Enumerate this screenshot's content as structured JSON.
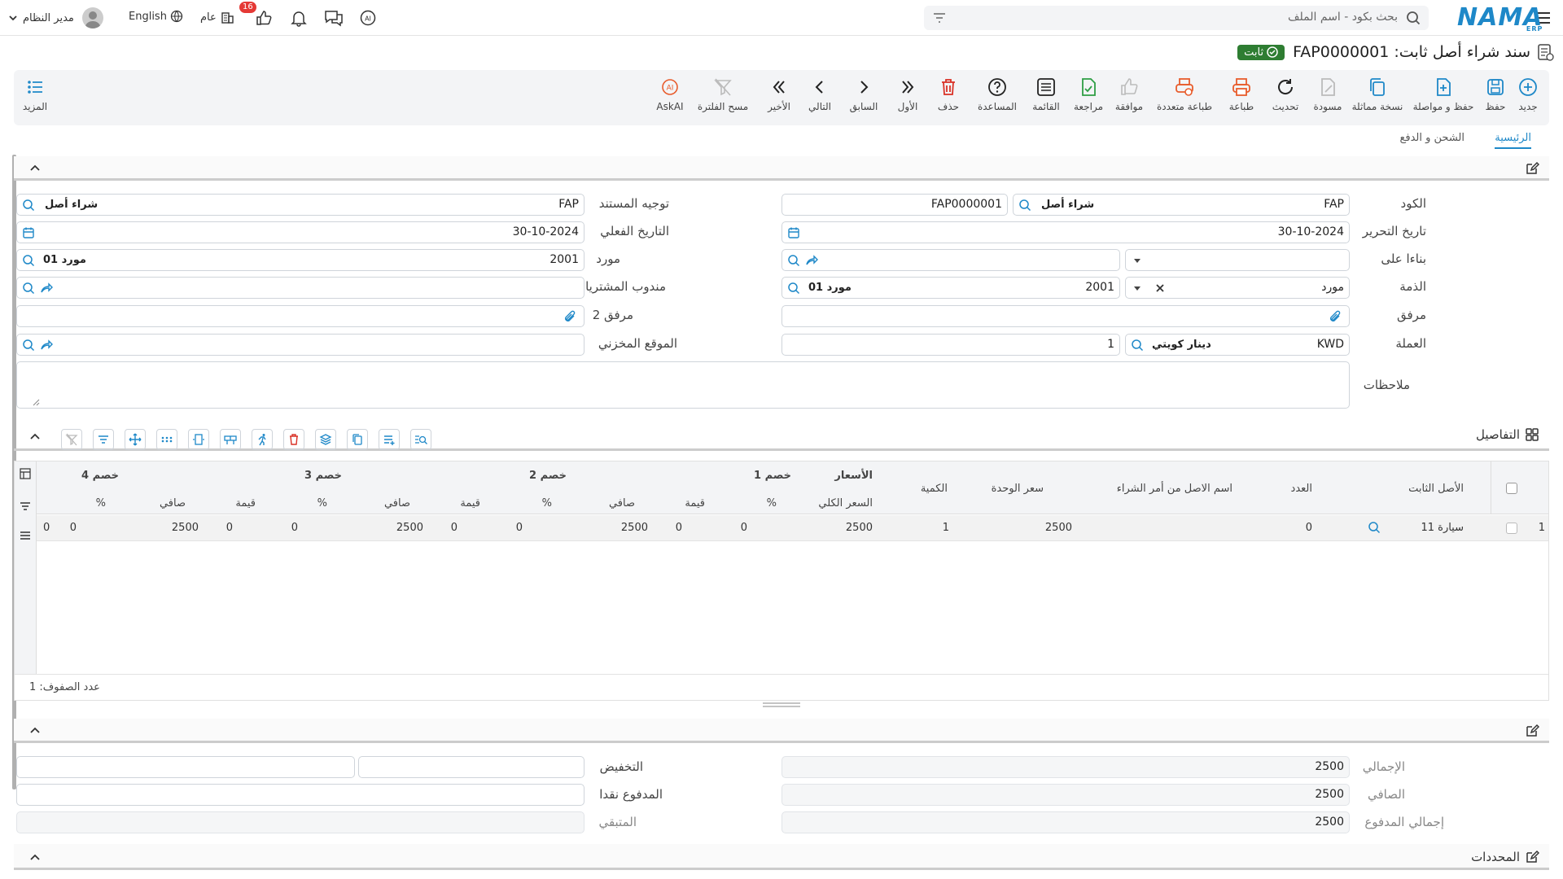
{
  "topbar": {
    "search_placeholder": "بحث بكود - اسم الملف",
    "logo": "NAMA",
    "logo_sub": "ERP",
    "user_name": "مدير النظام",
    "language": "English",
    "general": "عام",
    "notif_count": "16"
  },
  "title": {
    "text": "سند شراء أصل ثابت: FAP0000001",
    "status": "ثابت"
  },
  "toolbar": {
    "new": "جديد",
    "save": "حفظ",
    "save_continue": "حفظ و مواصلة",
    "duplicate": "نسخة مماثلة",
    "draft": "مسودة",
    "refresh": "تحديث",
    "print": "طباعة",
    "multi_print": "طباعة متعددة",
    "approve": "موافقة",
    "review": "مراجعة",
    "list": "القائمة",
    "help": "المساعدة",
    "delete": "حذف",
    "first": "الأول",
    "previous": "السابق",
    "next": "التالي",
    "last": "الأخير",
    "clear_filter": "مسح الفلترة",
    "askai": "AskAI",
    "more": "المزيد"
  },
  "tabs": {
    "main": "الرئيسية",
    "shipping": "الشحن و الدفع"
  },
  "form": {
    "code_label": "الكود",
    "code_value": "FAP",
    "code_type": "شراء أصل",
    "code_number": "FAP0000001",
    "date_label": "تاريخ التحرير",
    "date_value": "30-10-2024",
    "based_on_label": "بناءا على",
    "liability_label": "الذمة",
    "liability_type": "مورد",
    "liability_code": "2001",
    "liability_name": "مورد 01",
    "attachment_label": "مرفق",
    "currency_label": "العملة",
    "currency_code": "KWD",
    "currency_name": "دينار كويتي",
    "currency_rate": "1",
    "notes_label": "ملاحظات",
    "direction_label": "توجيه المستند",
    "direction_value": "FAP",
    "direction_type": "شراء أصل",
    "actual_date_label": "التاريخ الفعلي",
    "actual_date_value": "30-10-2024",
    "supplier_label": "مورد",
    "supplier_code": "2001",
    "supplier_name": "مورد 01",
    "rep_label": "مندوب المشتريات",
    "attachment2_label": "مرفق 2",
    "warehouse_label": "الموقع المخزني"
  },
  "details": {
    "title": "التفاصيل",
    "headers": {
      "asset": "الأصل الثابت",
      "count": "العدد",
      "po_name": "اسم الاصل من أمر الشراء",
      "unit_price": "سعر الوحدة",
      "qty": "الكمية",
      "prices_group": "الأسعار",
      "total_price": "السعر الكلي",
      "disc1": "خصم 1",
      "disc2": "خصم 2",
      "disc3": "خصم 3",
      "disc4": "خصم 4",
      "pct": "%",
      "value": "قيمة",
      "net": "صافي"
    },
    "rows": [
      {
        "idx": "1",
        "asset": "سيارة 11",
        "count": "0",
        "po_name": "",
        "unit_price": "2500",
        "qty": "1",
        "total": "2500",
        "d1_pct": "0",
        "d1_val": "0",
        "d1_net": "2500",
        "d2_pct": "0",
        "d2_val": "0",
        "d2_net": "2500",
        "d3_pct": "0",
        "d3_val": "0",
        "d3_net": "2500",
        "d4_val": "0",
        "d4_pct": "0"
      }
    ],
    "row_count": "عدد الصفوف: 1"
  },
  "totals": {
    "total_label": "الإجمالي",
    "total_value": "2500",
    "net_label": "الصافي",
    "net_value": "2500",
    "paid_total_label": "إجمالي المدفوع",
    "paid_total_value": "2500",
    "discount_label": "التخفيض",
    "cash_paid_label": "المدفوع نقدا",
    "remaining_label": "المتبقي"
  },
  "determinants": {
    "title": "المحددات"
  }
}
